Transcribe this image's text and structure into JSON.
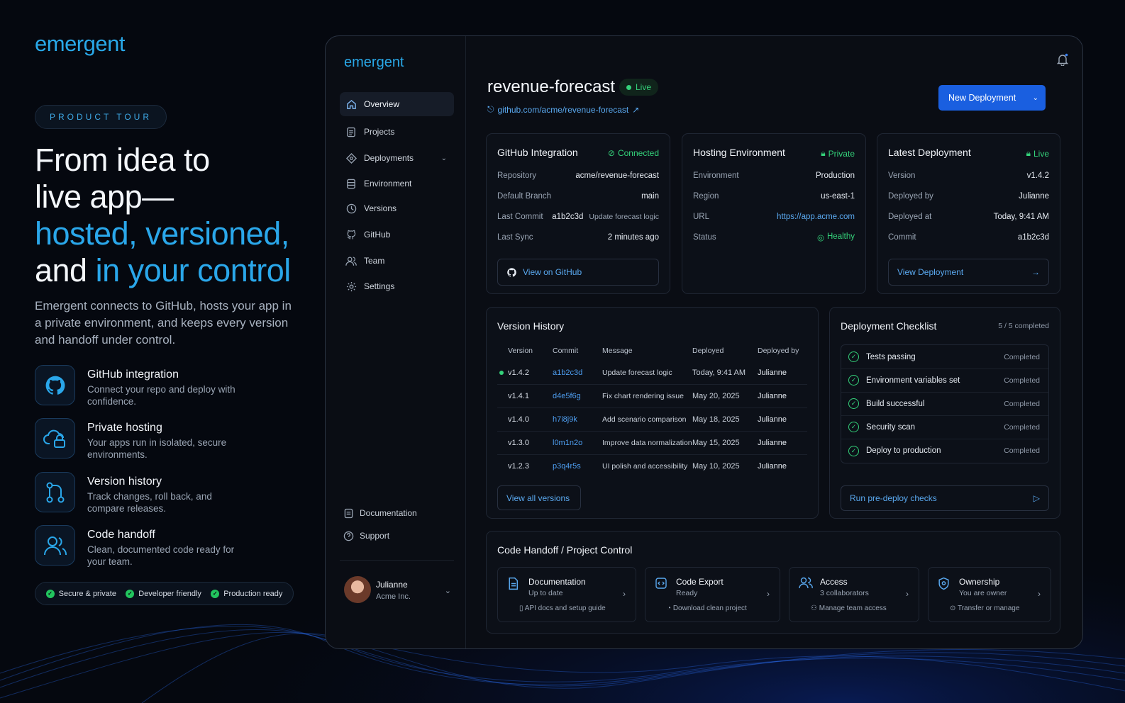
{
  "colors": {
    "accent": "#29a8e8",
    "primary": "#1a5fe0",
    "success": "#34d27a",
    "link": "#5aa9f0"
  },
  "left": {
    "logo": "emergent",
    "pill": "PRODUCT TOUR",
    "hero": {
      "line1": "From idea to",
      "line2": "live app—",
      "line3": "hosted, versioned,",
      "line4a": "and ",
      "line4b": "in your control"
    },
    "lead": "Emergent connects to GitHub, hosts your app in a private environment, and keeps every version and handoff under control.",
    "features": [
      {
        "icon": "github-icon",
        "title": "GitHub integration",
        "desc": "Connect your repo and deploy with confidence."
      },
      {
        "icon": "cloud-lock-icon",
        "title": "Private hosting",
        "desc": "Your apps run in isolated, secure environments."
      },
      {
        "icon": "git-branch-icon",
        "title": "Version history",
        "desc": "Track changes, roll back, and compare releases."
      },
      {
        "icon": "users-icon",
        "title": "Code handoff",
        "desc": "Clean, documented code ready for your team."
      }
    ],
    "badges": [
      "Secure & private",
      "Developer friendly",
      "Production ready"
    ]
  },
  "sidebar": {
    "logo": "emergent",
    "items": [
      {
        "label": "Overview",
        "icon": "home-icon"
      },
      {
        "label": "Projects",
        "icon": "file-icon"
      },
      {
        "label": "Deployments",
        "icon": "diamond-icon"
      },
      {
        "label": "Environment",
        "icon": "server-icon"
      },
      {
        "label": "Versions",
        "icon": "clock-icon"
      },
      {
        "label": "GitHub",
        "icon": "github-icon"
      },
      {
        "label": "Team",
        "icon": "users-icon"
      },
      {
        "label": "Settings",
        "icon": "gear-icon"
      }
    ],
    "footer": [
      {
        "label": "Documentation",
        "icon": "doc-icon"
      },
      {
        "label": "Support",
        "icon": "help-icon"
      }
    ],
    "user": {
      "name": "Julianne",
      "org": "Acme Inc."
    }
  },
  "header": {
    "title": "revenue-forecast",
    "status": "Live",
    "repo": "github.com/acme/revenue-forecast",
    "new_button": "New Deployment"
  },
  "github_card": {
    "title": "GitHub Integration",
    "status": "Connected",
    "rows": [
      {
        "k": "Repository",
        "v": "acme/revenue-forecast"
      },
      {
        "k": "Default Branch",
        "v": "main"
      },
      {
        "k": "Last Commit",
        "v": "a1b2c3d",
        "v2": "Update forecast logic"
      },
      {
        "k": "Last Sync",
        "v": "2 minutes ago"
      }
    ],
    "button": "View on GitHub"
  },
  "hosting_card": {
    "title": "Hosting Environment",
    "status": "Private",
    "rows": [
      {
        "k": "Environment",
        "v": "Production"
      },
      {
        "k": "Region",
        "v": "us-east-1"
      },
      {
        "k": "URL",
        "v": "https://app.acme.com"
      },
      {
        "k": "Status",
        "v": "Healthy"
      }
    ]
  },
  "latest_card": {
    "title": "Latest Deployment",
    "status": "Live",
    "rows": [
      {
        "k": "Version",
        "v": "v1.4.2"
      },
      {
        "k": "Deployed by",
        "v": "Julianne"
      },
      {
        "k": "Deployed at",
        "v": "Today, 9:41 AM"
      },
      {
        "k": "Commit",
        "v": "a1b2c3d"
      }
    ],
    "button": "View Deployment"
  },
  "versions": {
    "title": "Version History",
    "headers": [
      "Version",
      "Commit",
      "Message",
      "Deployed",
      "Deployed by"
    ],
    "rows": [
      {
        "version": "v1.4.2",
        "commit": "a1b2c3d",
        "message": "Update forecast logic",
        "deployed": "Today, 9:41 AM",
        "by": "Julianne"
      },
      {
        "version": "v1.4.1",
        "commit": "d4e5f6g",
        "message": "Fix chart rendering issue",
        "deployed": "May 20, 2025",
        "by": "Julianne"
      },
      {
        "version": "v1.4.0",
        "commit": "h7i8j9k",
        "message": "Add scenario comparison",
        "deployed": "May 18, 2025",
        "by": "Julianne"
      },
      {
        "version": "v1.3.0",
        "commit": "l0m1n2o",
        "message": "Improve data normalization",
        "deployed": "May 15, 2025",
        "by": "Julianne"
      },
      {
        "version": "v1.2.3",
        "commit": "p3q4r5s",
        "message": "UI polish and accessibility",
        "deployed": "May 10, 2025",
        "by": "Julianne"
      }
    ],
    "button": "View all versions"
  },
  "checklist": {
    "title": "Deployment Checklist",
    "count": "5 / 5 completed",
    "items": [
      {
        "label": "Tests passing",
        "status": "Completed"
      },
      {
        "label": "Environment variables set",
        "status": "Completed"
      },
      {
        "label": "Build successful",
        "status": "Completed"
      },
      {
        "label": "Security scan",
        "status": "Completed"
      },
      {
        "label": "Deploy to production",
        "status": "Completed"
      }
    ],
    "button": "Run pre-deploy checks"
  },
  "handoff": {
    "title": "Code Handoff / Project Control",
    "cards": [
      {
        "icon": "doc-icon",
        "title": "Documentation",
        "sub": "Up to date",
        "foot": "API docs and setup guide"
      },
      {
        "icon": "code-icon",
        "title": "Code Export",
        "sub": "Ready",
        "foot": "Download clean project"
      },
      {
        "icon": "users-icon",
        "title": "Access",
        "sub": "3 collaborators",
        "foot": "Manage team access"
      },
      {
        "icon": "shield-icon",
        "title": "Ownership",
        "sub": "You are owner",
        "foot": "Transfer or manage"
      }
    ]
  }
}
